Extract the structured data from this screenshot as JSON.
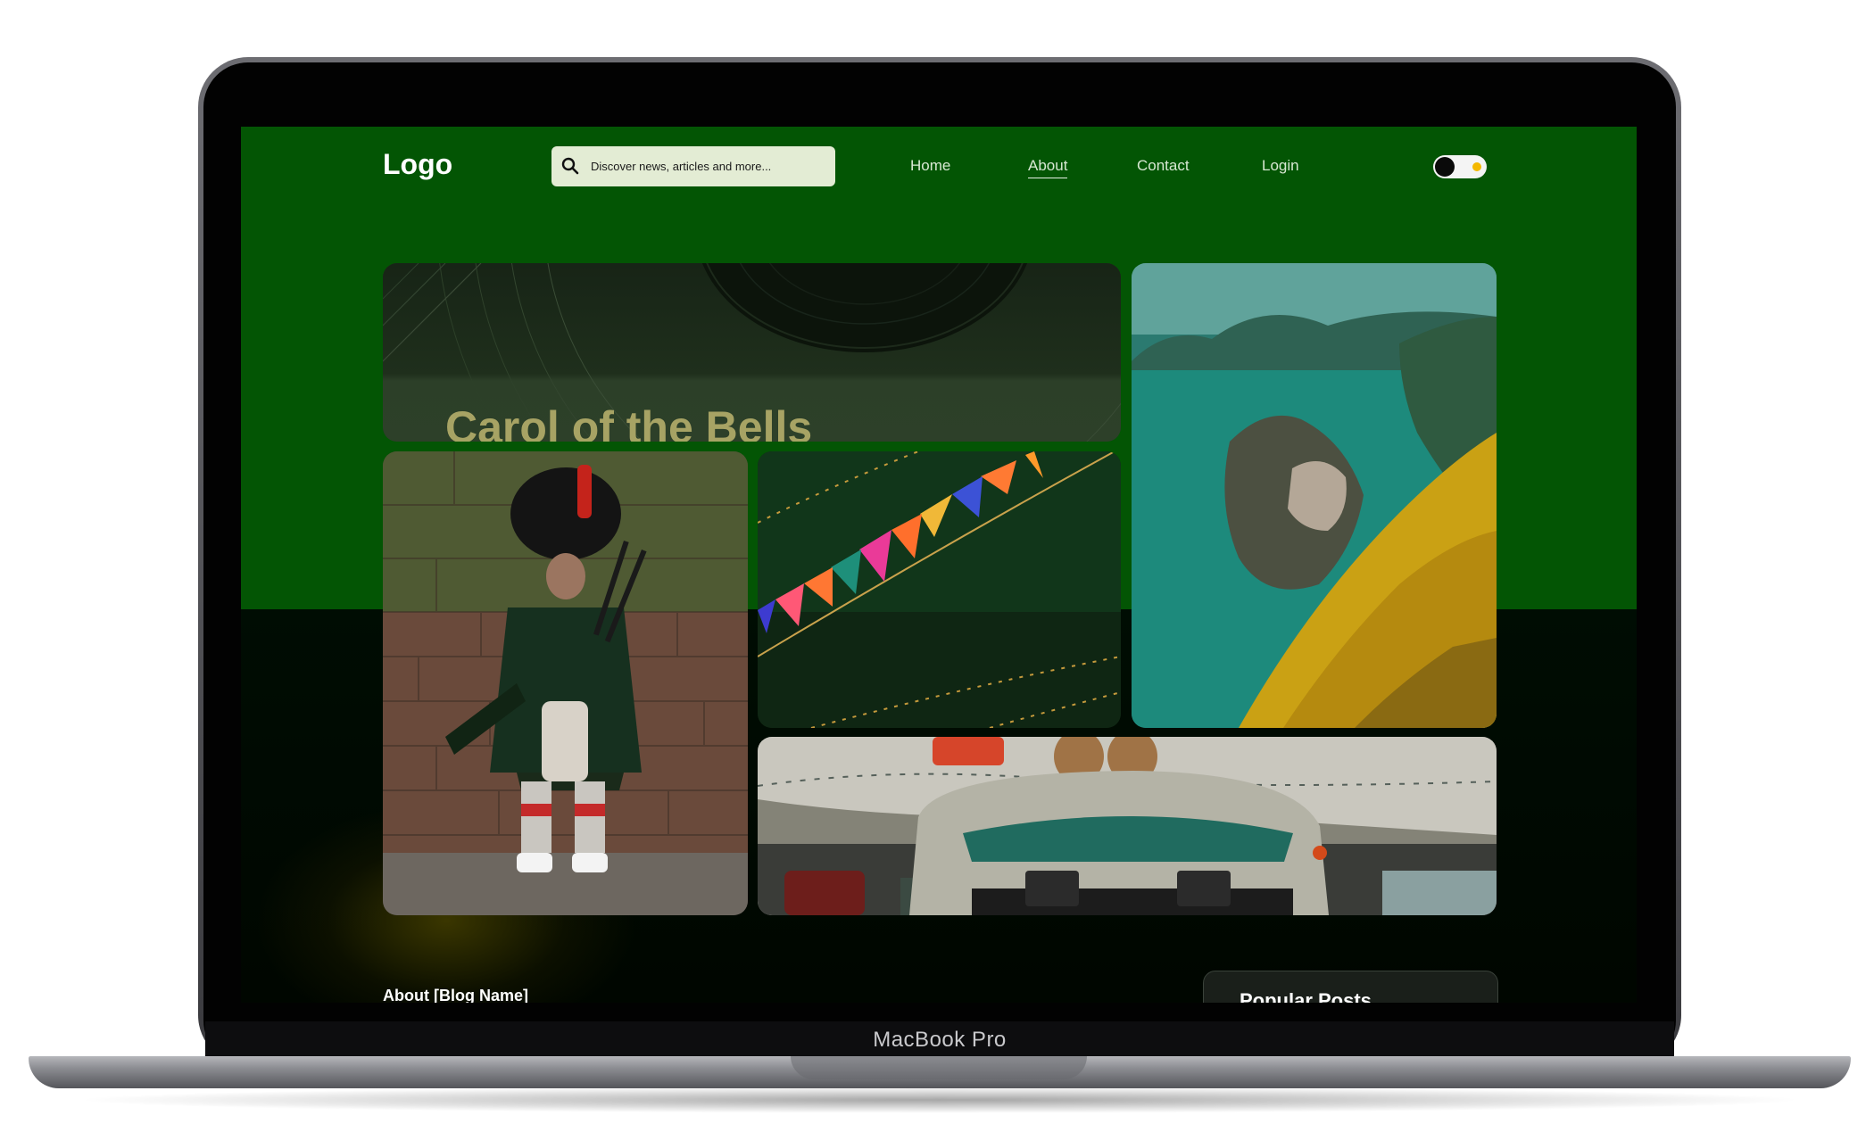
{
  "device": {
    "label": "MacBook Pro"
  },
  "header": {
    "logo": "Logo",
    "search": {
      "placeholder": "Discover news, articles and more..."
    },
    "nav": [
      {
        "label": "Home"
      },
      {
        "label": "About",
        "active": true
      },
      {
        "label": "Contact"
      },
      {
        "label": "Login"
      }
    ],
    "theme_toggle": {
      "state": "off"
    }
  },
  "featured": {
    "title": "Carol of the Bells"
  },
  "gallery": [
    {
      "icon": "vinyl-record-image"
    },
    {
      "icon": "bagpiper-photo"
    },
    {
      "icon": "bunting-flags-photo"
    },
    {
      "icon": "coastal-village-photo"
    },
    {
      "icon": "vintage-car-photo"
    }
  ],
  "sections": {
    "about_title": "About [Blog Name]",
    "popular_title": "Popular Posts"
  },
  "controls": {
    "scroll_icon": "chevron-down-icon"
  },
  "colors": {
    "header_green": "#035504",
    "page_dark": "#000a02",
    "search_bg": "#e3ecd4",
    "featured_title": "#a7a364",
    "toggle_dot": "#f4b800"
  }
}
